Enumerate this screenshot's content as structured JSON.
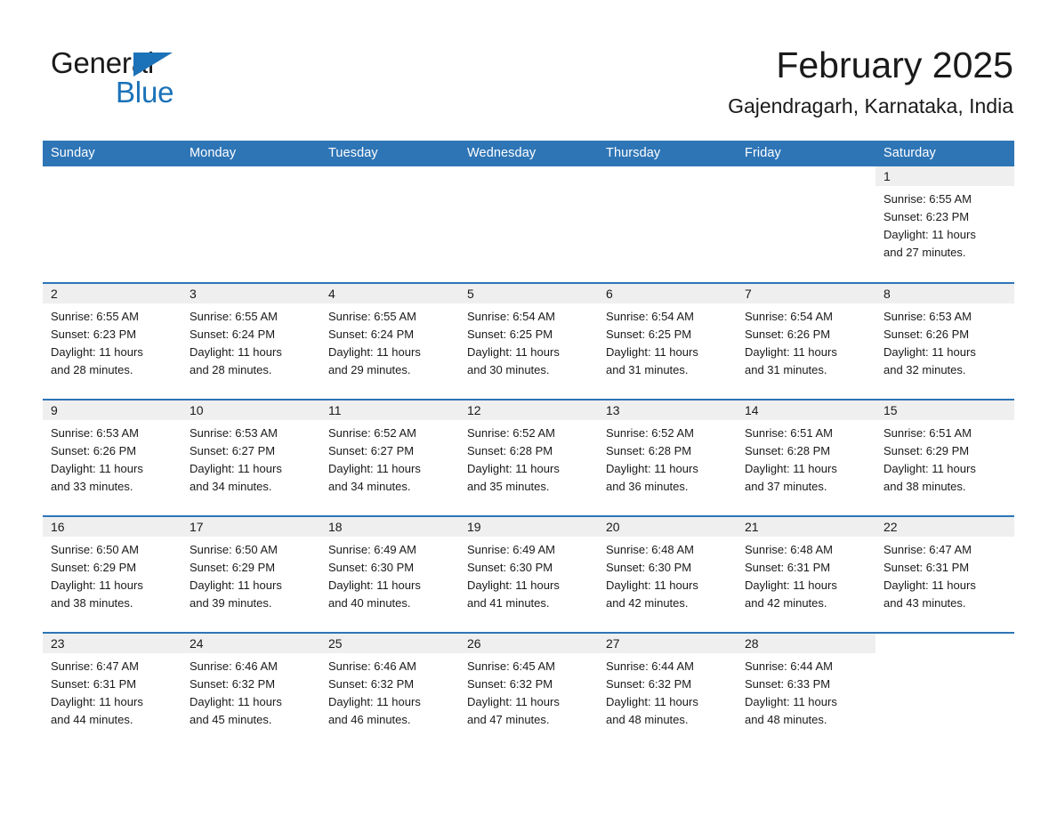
{
  "brand": {
    "name_part1": "General",
    "name_part2": "Blue",
    "triangle_color": "#1b72b8"
  },
  "header": {
    "title": "February 2025",
    "subtitle": "Gajendragarh, Karnataka, India"
  },
  "theme": {
    "header_blue": "#2e75b6",
    "daynum_gray": "#efefef",
    "text": "#1a1a1a"
  },
  "calendar": {
    "weekdays": [
      "Sunday",
      "Monday",
      "Tuesday",
      "Wednesday",
      "Thursday",
      "Friday",
      "Saturday"
    ],
    "weeks": [
      [
        {
          "day": "",
          "sunrise": "",
          "sunset": "",
          "daylight1": "",
          "daylight2": "",
          "blank": true
        },
        {
          "day": "",
          "sunrise": "",
          "sunset": "",
          "daylight1": "",
          "daylight2": "",
          "blank": true
        },
        {
          "day": "",
          "sunrise": "",
          "sunset": "",
          "daylight1": "",
          "daylight2": "",
          "blank": true
        },
        {
          "day": "",
          "sunrise": "",
          "sunset": "",
          "daylight1": "",
          "daylight2": "",
          "blank": true
        },
        {
          "day": "",
          "sunrise": "",
          "sunset": "",
          "daylight1": "",
          "daylight2": "",
          "blank": true
        },
        {
          "day": "",
          "sunrise": "",
          "sunset": "",
          "daylight1": "",
          "daylight2": "",
          "blank": true
        },
        {
          "day": "1",
          "sunrise": "Sunrise: 6:55 AM",
          "sunset": "Sunset: 6:23 PM",
          "daylight1": "Daylight: 11 hours",
          "daylight2": "and 27 minutes."
        }
      ],
      [
        {
          "day": "2",
          "sunrise": "Sunrise: 6:55 AM",
          "sunset": "Sunset: 6:23 PM",
          "daylight1": "Daylight: 11 hours",
          "daylight2": "and 28 minutes."
        },
        {
          "day": "3",
          "sunrise": "Sunrise: 6:55 AM",
          "sunset": "Sunset: 6:24 PM",
          "daylight1": "Daylight: 11 hours",
          "daylight2": "and 28 minutes."
        },
        {
          "day": "4",
          "sunrise": "Sunrise: 6:55 AM",
          "sunset": "Sunset: 6:24 PM",
          "daylight1": "Daylight: 11 hours",
          "daylight2": "and 29 minutes."
        },
        {
          "day": "5",
          "sunrise": "Sunrise: 6:54 AM",
          "sunset": "Sunset: 6:25 PM",
          "daylight1": "Daylight: 11 hours",
          "daylight2": "and 30 minutes."
        },
        {
          "day": "6",
          "sunrise": "Sunrise: 6:54 AM",
          "sunset": "Sunset: 6:25 PM",
          "daylight1": "Daylight: 11 hours",
          "daylight2": "and 31 minutes."
        },
        {
          "day": "7",
          "sunrise": "Sunrise: 6:54 AM",
          "sunset": "Sunset: 6:26 PM",
          "daylight1": "Daylight: 11 hours",
          "daylight2": "and 31 minutes."
        },
        {
          "day": "8",
          "sunrise": "Sunrise: 6:53 AM",
          "sunset": "Sunset: 6:26 PM",
          "daylight1": "Daylight: 11 hours",
          "daylight2": "and 32 minutes."
        }
      ],
      [
        {
          "day": "9",
          "sunrise": "Sunrise: 6:53 AM",
          "sunset": "Sunset: 6:26 PM",
          "daylight1": "Daylight: 11 hours",
          "daylight2": "and 33 minutes."
        },
        {
          "day": "10",
          "sunrise": "Sunrise: 6:53 AM",
          "sunset": "Sunset: 6:27 PM",
          "daylight1": "Daylight: 11 hours",
          "daylight2": "and 34 minutes."
        },
        {
          "day": "11",
          "sunrise": "Sunrise: 6:52 AM",
          "sunset": "Sunset: 6:27 PM",
          "daylight1": "Daylight: 11 hours",
          "daylight2": "and 34 minutes."
        },
        {
          "day": "12",
          "sunrise": "Sunrise: 6:52 AM",
          "sunset": "Sunset: 6:28 PM",
          "daylight1": "Daylight: 11 hours",
          "daylight2": "and 35 minutes."
        },
        {
          "day": "13",
          "sunrise": "Sunrise: 6:52 AM",
          "sunset": "Sunset: 6:28 PM",
          "daylight1": "Daylight: 11 hours",
          "daylight2": "and 36 minutes."
        },
        {
          "day": "14",
          "sunrise": "Sunrise: 6:51 AM",
          "sunset": "Sunset: 6:28 PM",
          "daylight1": "Daylight: 11 hours",
          "daylight2": "and 37 minutes."
        },
        {
          "day": "15",
          "sunrise": "Sunrise: 6:51 AM",
          "sunset": "Sunset: 6:29 PM",
          "daylight1": "Daylight: 11 hours",
          "daylight2": "and 38 minutes."
        }
      ],
      [
        {
          "day": "16",
          "sunrise": "Sunrise: 6:50 AM",
          "sunset": "Sunset: 6:29 PM",
          "daylight1": "Daylight: 11 hours",
          "daylight2": "and 38 minutes."
        },
        {
          "day": "17",
          "sunrise": "Sunrise: 6:50 AM",
          "sunset": "Sunset: 6:29 PM",
          "daylight1": "Daylight: 11 hours",
          "daylight2": "and 39 minutes."
        },
        {
          "day": "18",
          "sunrise": "Sunrise: 6:49 AM",
          "sunset": "Sunset: 6:30 PM",
          "daylight1": "Daylight: 11 hours",
          "daylight2": "and 40 minutes."
        },
        {
          "day": "19",
          "sunrise": "Sunrise: 6:49 AM",
          "sunset": "Sunset: 6:30 PM",
          "daylight1": "Daylight: 11 hours",
          "daylight2": "and 41 minutes."
        },
        {
          "day": "20",
          "sunrise": "Sunrise: 6:48 AM",
          "sunset": "Sunset: 6:30 PM",
          "daylight1": "Daylight: 11 hours",
          "daylight2": "and 42 minutes."
        },
        {
          "day": "21",
          "sunrise": "Sunrise: 6:48 AM",
          "sunset": "Sunset: 6:31 PM",
          "daylight1": "Daylight: 11 hours",
          "daylight2": "and 42 minutes."
        },
        {
          "day": "22",
          "sunrise": "Sunrise: 6:47 AM",
          "sunset": "Sunset: 6:31 PM",
          "daylight1": "Daylight: 11 hours",
          "daylight2": "and 43 minutes."
        }
      ],
      [
        {
          "day": "23",
          "sunrise": "Sunrise: 6:47 AM",
          "sunset": "Sunset: 6:31 PM",
          "daylight1": "Daylight: 11 hours",
          "daylight2": "and 44 minutes."
        },
        {
          "day": "24",
          "sunrise": "Sunrise: 6:46 AM",
          "sunset": "Sunset: 6:32 PM",
          "daylight1": "Daylight: 11 hours",
          "daylight2": "and 45 minutes."
        },
        {
          "day": "25",
          "sunrise": "Sunrise: 6:46 AM",
          "sunset": "Sunset: 6:32 PM",
          "daylight1": "Daylight: 11 hours",
          "daylight2": "and 46 minutes."
        },
        {
          "day": "26",
          "sunrise": "Sunrise: 6:45 AM",
          "sunset": "Sunset: 6:32 PM",
          "daylight1": "Daylight: 11 hours",
          "daylight2": "and 47 minutes."
        },
        {
          "day": "27",
          "sunrise": "Sunrise: 6:44 AM",
          "sunset": "Sunset: 6:32 PM",
          "daylight1": "Daylight: 11 hours",
          "daylight2": "and 48 minutes."
        },
        {
          "day": "28",
          "sunrise": "Sunrise: 6:44 AM",
          "sunset": "Sunset: 6:33 PM",
          "daylight1": "Daylight: 11 hours",
          "daylight2": "and 48 minutes."
        },
        {
          "day": "",
          "sunrise": "",
          "sunset": "",
          "daylight1": "",
          "daylight2": "",
          "blank": true
        }
      ]
    ]
  }
}
